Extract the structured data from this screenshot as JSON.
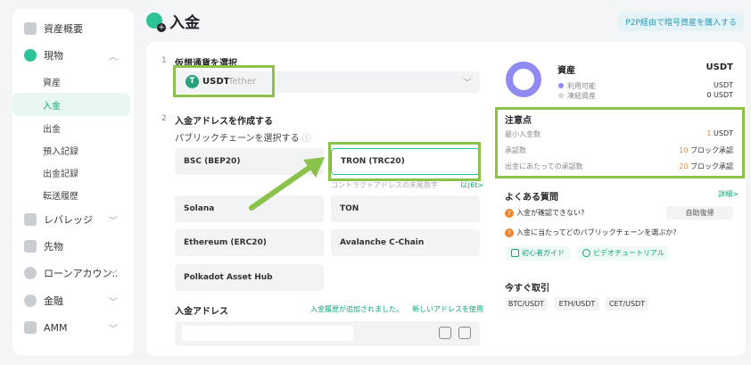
{
  "sidebar": {
    "items": [
      {
        "label": "資産概要",
        "icon": "dashboard-icon"
      },
      {
        "label": "現物",
        "icon": "spot-icon",
        "expanded": true
      },
      {
        "label": "資産",
        "sub": true
      },
      {
        "label": "入金",
        "sub": true,
        "active": true
      },
      {
        "label": "出金",
        "sub": true
      },
      {
        "label": "預入記録",
        "sub": true
      },
      {
        "label": "出金記録",
        "sub": true
      },
      {
        "label": "転送履歴",
        "sub": true
      },
      {
        "label": "レバレッジ",
        "icon": "leverage-icon"
      },
      {
        "label": "先物",
        "icon": "futures-icon"
      },
      {
        "label": "ローンアカウン..",
        "icon": "loan-icon"
      },
      {
        "label": "金融",
        "icon": "finance-icon"
      },
      {
        "label": "AMM",
        "icon": "amm-icon"
      }
    ]
  },
  "header": {
    "title": "入金",
    "p2p_button": "P2P経由で暗号資産を購入する"
  },
  "step1": {
    "num": "1",
    "title": "仮想通貨を選択",
    "coin": "USDT",
    "coin_name": "Tether",
    "coin_icon_letter": "T"
  },
  "step2": {
    "num": "2",
    "title": "入金アドレスを作成する",
    "chain_label": "パブリックチェーンを選択する",
    "chains": [
      "BSC (BEP20)",
      "TRON (TRC20)",
      "Solana",
      "TON",
      "Ethereum (ERC20)",
      "Avalanche C-Chain",
      "Polkadot Asset Hub"
    ],
    "selected_chain": "TRON (TRC20)",
    "contract_text": "コントラクトアドレスの末尾数字",
    "view_link": "以(6t>"
  },
  "address": {
    "title": "入金アドレス",
    "note": "入金履歴が追加されました。",
    "new_address": "新しいアドレスを使用"
  },
  "assets": {
    "title": "資産",
    "currency": "USDT",
    "available_label": "利用可能",
    "available_value": "USDT",
    "frozen_label": "凍結資産",
    "frozen_value": "0 USDT",
    "colors": {
      "available": "#8f8bf2",
      "frozen": "#d9d9d9"
    }
  },
  "notice": {
    "title": "注意点",
    "rows": [
      {
        "label": "最小入金数",
        "hl": "1",
        "rest": " USDT"
      },
      {
        "label": "承認数",
        "hl": "10",
        "rest": " ブロック承認"
      },
      {
        "label": "出金にあたっての承認数",
        "hl": "20",
        "rest": " ブロック承認"
      }
    ]
  },
  "faq": {
    "title": "よくある質問",
    "more": "詳細>",
    "q1": "入金が確認できない?",
    "auto_button": "自助復帰",
    "q2": "入金に当たってどのパブリックチェーンを選ぶか?",
    "guide_button": "初心者ガイド",
    "video_button": "ビデオチュートリアル"
  },
  "trade": {
    "title": "今すぐ取引",
    "pairs": [
      "BTC/USDT",
      "ETH/USDT",
      "CET/USDT"
    ]
  },
  "accent_color": "#11a37a",
  "annotation_color": "#8bc34a"
}
